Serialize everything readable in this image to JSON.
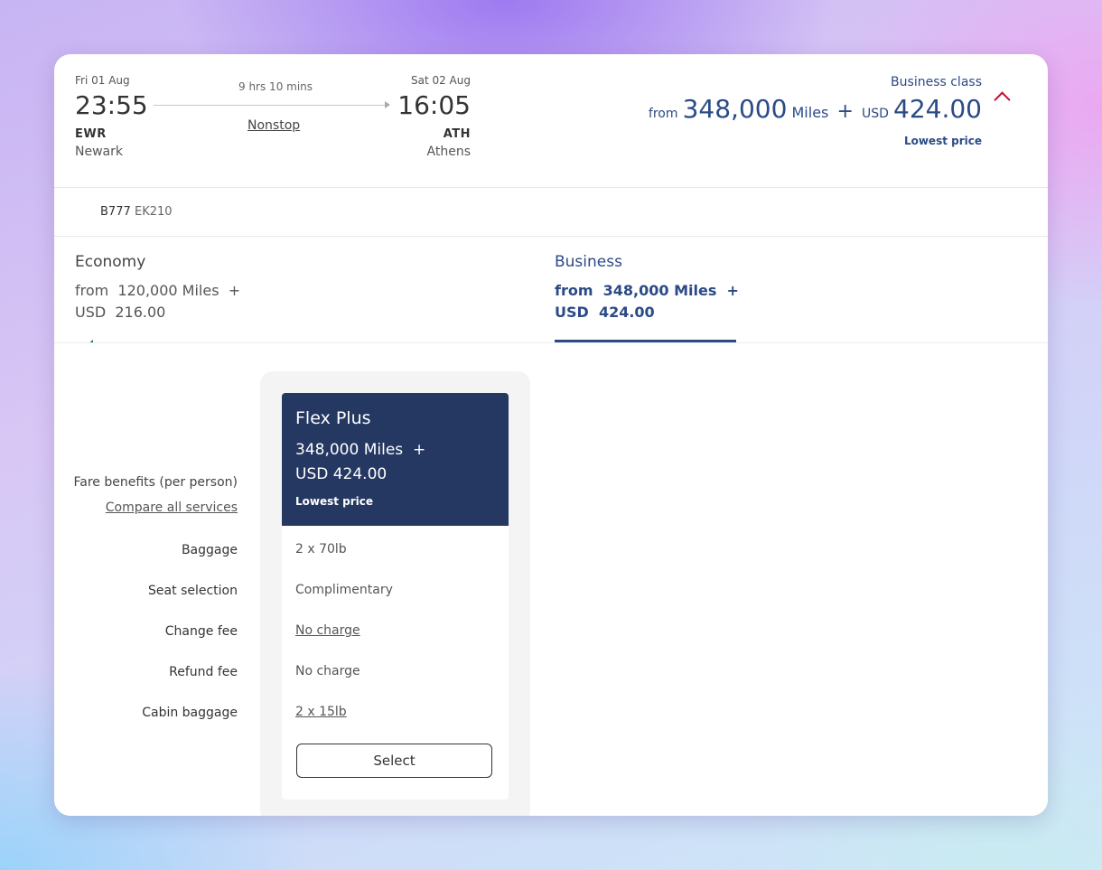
{
  "flight": {
    "dep_date": "Fri 01 Aug",
    "dep_time": "23:55",
    "dep_code": "EWR",
    "dep_city": "Newark",
    "duration": "9 hrs 10 mins",
    "stops": "Nonstop",
    "arr_date": "Sat 02 Aug",
    "arr_time": "16:05",
    "arr_code": "ATH",
    "arr_city": "Athens"
  },
  "summary": {
    "cabin": "Business class",
    "from": "from",
    "miles_value": "348,000",
    "miles_unit": "Miles",
    "plus": "+",
    "currency": "USD",
    "amount": "424.00",
    "badge": "Lowest price"
  },
  "aircraft": {
    "type": "B777",
    "flight_number": "EK210"
  },
  "cabin_tabs": [
    {
      "label": "Economy",
      "from": "from",
      "miles": "120,000 Miles",
      "plus": "+",
      "currency": "USD",
      "amount": "216.00",
      "selected": false
    },
    {
      "label": "Business",
      "from": "from",
      "miles": "348,000 Miles",
      "plus": "+",
      "currency": "USD",
      "amount": "424.00",
      "selected": true
    }
  ],
  "benefits": {
    "title": "Fare benefits (per person)",
    "compare_link": "Compare all services",
    "rows": [
      {
        "label": "Baggage",
        "value": "2 x 70lb"
      },
      {
        "label": "Seat selection",
        "value": "Complimentary"
      },
      {
        "label": "Change fee",
        "value": "No charge"
      },
      {
        "label": "Refund fee",
        "value": "No charge"
      },
      {
        "label": "Cabin baggage",
        "value": "2 x 15lb"
      }
    ]
  },
  "fare": {
    "name": "Flex Plus",
    "miles": "348,000 Miles",
    "plus": "+",
    "price": "USD 424.00",
    "badge": "Lowest price",
    "select_label": "Select"
  },
  "colors": {
    "brand_blue": "#2b4a86",
    "fare_header": "#243862",
    "accent_red": "#c8102e"
  },
  "icons": {
    "airline_logo": "airline-logo-icon",
    "collapse": "chevron-up-icon",
    "arrow": "arrow-right-icon"
  }
}
